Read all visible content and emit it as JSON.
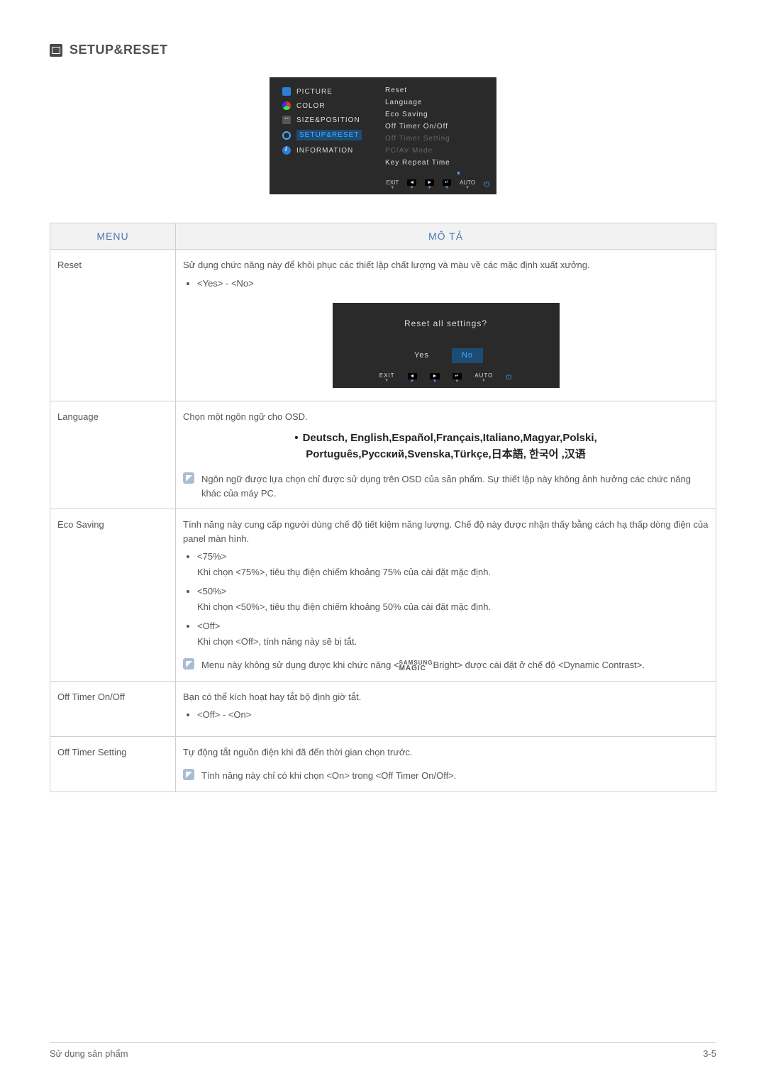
{
  "heading": "SETUP&RESET",
  "osd": {
    "left": [
      {
        "label": "PICTURE"
      },
      {
        "label": "COLOR"
      },
      {
        "label": "SIZE&POSITION"
      },
      {
        "label": "SETUP&RESET"
      },
      {
        "label": "INFORMATION"
      }
    ],
    "right": [
      {
        "label": "Reset",
        "dim": false
      },
      {
        "label": "Language",
        "dim": false
      },
      {
        "label": "Eco Saving",
        "dim": false
      },
      {
        "label": "Off Timer On/Off",
        "dim": false
      },
      {
        "label": "Off Timer Setting",
        "dim": true
      },
      {
        "label": "PC/AV Mode",
        "dim": true
      },
      {
        "label": "Key Repeat Time",
        "dim": false
      }
    ],
    "foot": {
      "exit": "EXIT",
      "auto": "AUTO"
    }
  },
  "table": {
    "head_menu": "MENU",
    "head_desc": "MÔ TẢ",
    "rows": {
      "reset": {
        "name": "Reset",
        "desc": "Sử dụng chức năng này để khôi phục các thiết lập chất lượng và màu về các mặc định xuất xưởng.",
        "opt": "<Yes> - <No>",
        "dlg": {
          "q": "Reset all settings?",
          "yes": "Yes",
          "no": "No",
          "exit": "EXIT",
          "auto": "AUTO"
        }
      },
      "language": {
        "name": "Language",
        "desc": "Chọn một ngôn ngữ cho OSD.",
        "langs1": "Deutsch, English,Español,Français,Italiano,Magyar,Polski,",
        "langs2": "Português,Русский,Svenska,Türkçe,日本語, 한국어 ,汉语",
        "note": "Ngôn ngữ được lựa chọn chỉ được sử dụng trên OSD của sản phẩm. Sự thiết lập này không ảnh hưởng các chức năng khác của máy PC."
      },
      "eco": {
        "name": "Eco Saving",
        "desc": "Tính năng này cung cấp người dùng chế độ tiết kiệm năng lượng. Chế độ này được nhận thấy bằng cách hạ thấp dòng điện của panel màn hình.",
        "o1": "<75%>",
        "o1d": "Khi chọn <75%>, tiêu thụ điện chiếm khoảng 75% của cài đặt mặc định.",
        "o2": "<50%>",
        "o2d": "Khi chọn <50%>, tiêu thụ điện chiếm khoảng 50% của cài đặt mặc định.",
        "o3": "<Off>",
        "o3d": "Khi chọn <Off>, tính năng này sẽ bị tắt.",
        "note_a": "Menu này không sử dụng được khi chức năng <",
        "note_b": "Bright> được cài đặt ở chế độ <Dynamic Contrast>.",
        "magic_s": "SAMSUNG",
        "magic_m": "MAGIC"
      },
      "timer": {
        "name": "Off Timer On/Off",
        "desc": "Bạn có thể kích hoạt hay tắt bộ định giờ tắt.",
        "opt": "<Off> - <On>"
      },
      "timer_set": {
        "name": "Off Timer Setting",
        "desc": "Tự động tắt nguồn điện khi đã đến thời gian chọn trước.",
        "note": "Tính năng này chỉ có khi chọn <On> trong <Off Timer On/Off>."
      }
    }
  },
  "footer": {
    "left": "Sử dụng sản phẩm",
    "right": "3-5"
  }
}
